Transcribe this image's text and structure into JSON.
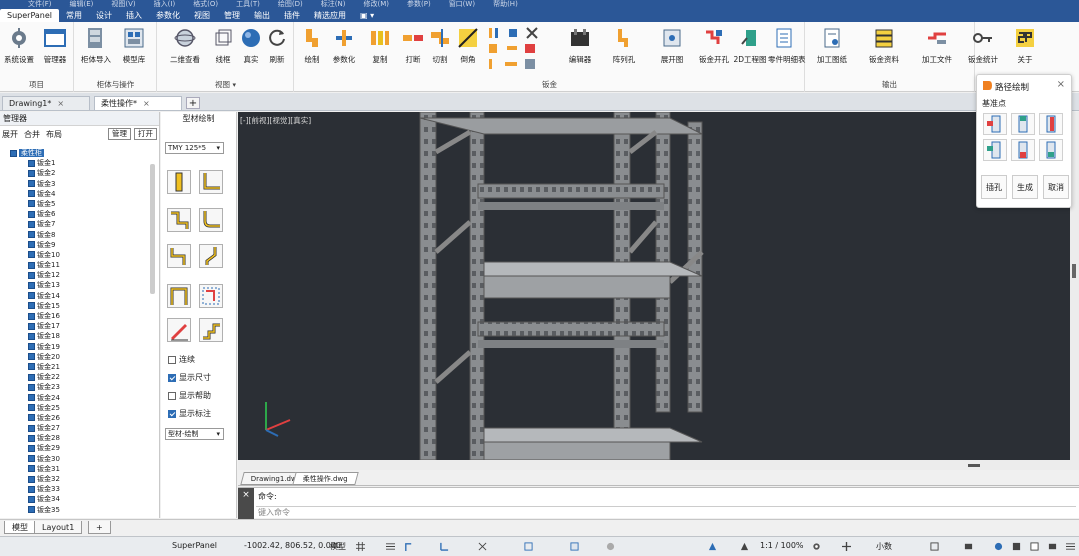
{
  "menubar": {
    "items": [
      "文件(F)",
      "编辑(E)",
      "视图(V)",
      "插入(I)",
      "格式(O)",
      "工具(T)",
      "绘图(D)",
      "标注(N)",
      "修改(M)",
      "参数(P)",
      "窗口(W)",
      "帮助(H)"
    ]
  },
  "ribbon_tabs": [
    "SuperPanel",
    "常用",
    "设计",
    "插入",
    "参数化",
    "视图",
    "管理",
    "输出",
    "插件",
    "精选应用",
    "▣ ▾"
  ],
  "ribbon": {
    "groups": [
      {
        "label": "项目",
        "buttons": [
          "系统设置",
          "管理器"
        ]
      },
      {
        "label": "柜体与操作",
        "buttons": [
          "柜体导入",
          "模型库"
        ]
      },
      {
        "label": "视图",
        "buttons": [
          "二维查看",
          "线框",
          "真实",
          "刷新"
        ]
      },
      {
        "label": "钣金",
        "buttons": [
          "绘制",
          "参数化",
          "复制",
          "打断",
          "切割",
          "倒角",
          "",
          "编辑器",
          "阵列孔"
        ]
      },
      {
        "label": "输出",
        "buttons": [
          "展开图",
          "钣金开孔",
          "2D工程图",
          "零件明细表",
          "加工图纸",
          "钣金资料",
          "加工文件",
          "钣金统计",
          "关于"
        ]
      }
    ],
    "view_caret": "▾"
  },
  "doc_tabs": [
    {
      "label": "Drawing1*",
      "close": "×"
    },
    {
      "label": "柔性操作*",
      "close": "×"
    }
  ],
  "add_tab": "+",
  "manager": {
    "title": "管理器",
    "toolbar": [
      "展开",
      "合并",
      "布局"
    ],
    "buttons": [
      "管理",
      "打开"
    ],
    "root": "柔性柜",
    "items": [
      "钣金1",
      "钣金2",
      "钣金3",
      "钣金4",
      "钣金5",
      "钣金6",
      "钣金7",
      "钣金8",
      "钣金9",
      "钣金10",
      "钣金11",
      "钣金12",
      "钣金13",
      "钣金14",
      "钣金15",
      "钣金16",
      "钣金17",
      "钣金18",
      "钣金19",
      "钣金20",
      "钣金21",
      "钣金22",
      "钣金23",
      "钣金24",
      "钣金25",
      "钣金26",
      "钣金27",
      "钣金28",
      "钣金29",
      "钣金30",
      "钣金31",
      "钣金32",
      "钣金33",
      "钣金34",
      "钣金35"
    ]
  },
  "profile_panel": {
    "title": "型材绘制",
    "profile_select": "TMY 125*5",
    "checks": [
      {
        "label": "连续",
        "checked": false
      },
      {
        "label": "显示尺寸",
        "checked": true
      },
      {
        "label": "显示帮助",
        "checked": false
      },
      {
        "label": "显示标注",
        "checked": true
      }
    ],
    "mode_select": "型材-绘制"
  },
  "viewport": {
    "label": "[-][前视][视觉][真实]"
  },
  "layout_tabs": [
    "Drawing1.dwg",
    "柔性操作.dwg"
  ],
  "command": {
    "history": "命令:",
    "placeholder": "键入命令",
    "close": "×"
  },
  "bottom_tabs": [
    "模型",
    "Layout1",
    "+"
  ],
  "status": {
    "app": "SuperPanel",
    "coords": "-1002.42, 806.52, 0.000",
    "model": "模型",
    "ratio": "1:1 / 100%",
    "unit": "小数"
  },
  "float_panel": {
    "title": "路径绘制",
    "subtitle": "基准点",
    "actions": [
      "插孔",
      "生成",
      "取消"
    ],
    "close": "×"
  },
  "colors": {
    "accent": "#2b5797",
    "viewport": "#2b2f35"
  }
}
